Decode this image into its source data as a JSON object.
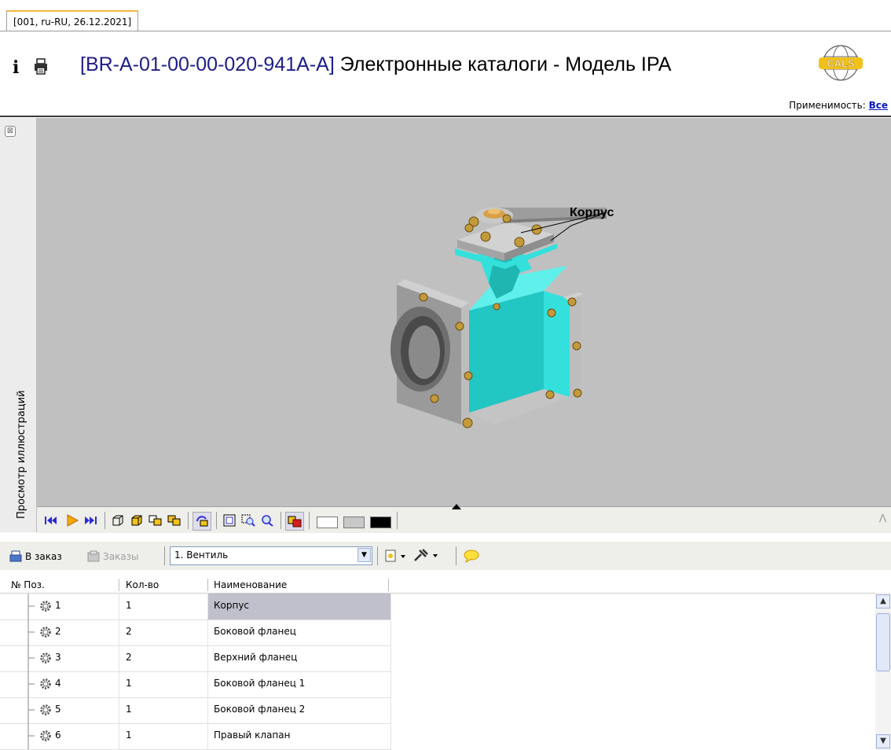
{
  "tab": {
    "label": "[001, ru-RU, 26.12.2021]"
  },
  "header": {
    "info_glyph": "i",
    "title_code": "[BR-A-01-00-00-020-941A-A]",
    "title_text": " Электронные каталоги - Модель IPA",
    "logo_icon": "cals-globe-logo"
  },
  "applicability": {
    "label": "Применимость:",
    "value": "Все"
  },
  "side_panel": {
    "label": "Просмотр иллюстраций",
    "close_glyph": "⊠"
  },
  "viewer": {
    "callout": "Корпус"
  },
  "colors": {
    "model_primary": "#33e0dc",
    "model_gray": "#a8a8a8",
    "viewport_bg": "#c0c0c0",
    "selected_row": "#c0c0cc",
    "title_code": "#1d1d8c"
  },
  "orderbar": {
    "to_order_label": "В заказ",
    "orders_label": "Заказы",
    "assembly_selected": "1. Вентиль"
  },
  "table": {
    "columns": [
      "№ Поз.",
      "Кол-во",
      "Наименование"
    ],
    "rows": [
      {
        "pos": "1",
        "qty": "1",
        "name": "Корпус",
        "selected": true
      },
      {
        "pos": "2",
        "qty": "2",
        "name": "Боковой фланец"
      },
      {
        "pos": "3",
        "qty": "2",
        "name": "Верхний фланец"
      },
      {
        "pos": "4",
        "qty": "1",
        "name": "Боковой фланец 1"
      },
      {
        "pos": "5",
        "qty": "1",
        "name": "Боковой фланец 2"
      },
      {
        "pos": "6",
        "qty": "1",
        "name": "Правый клапан"
      }
    ]
  }
}
